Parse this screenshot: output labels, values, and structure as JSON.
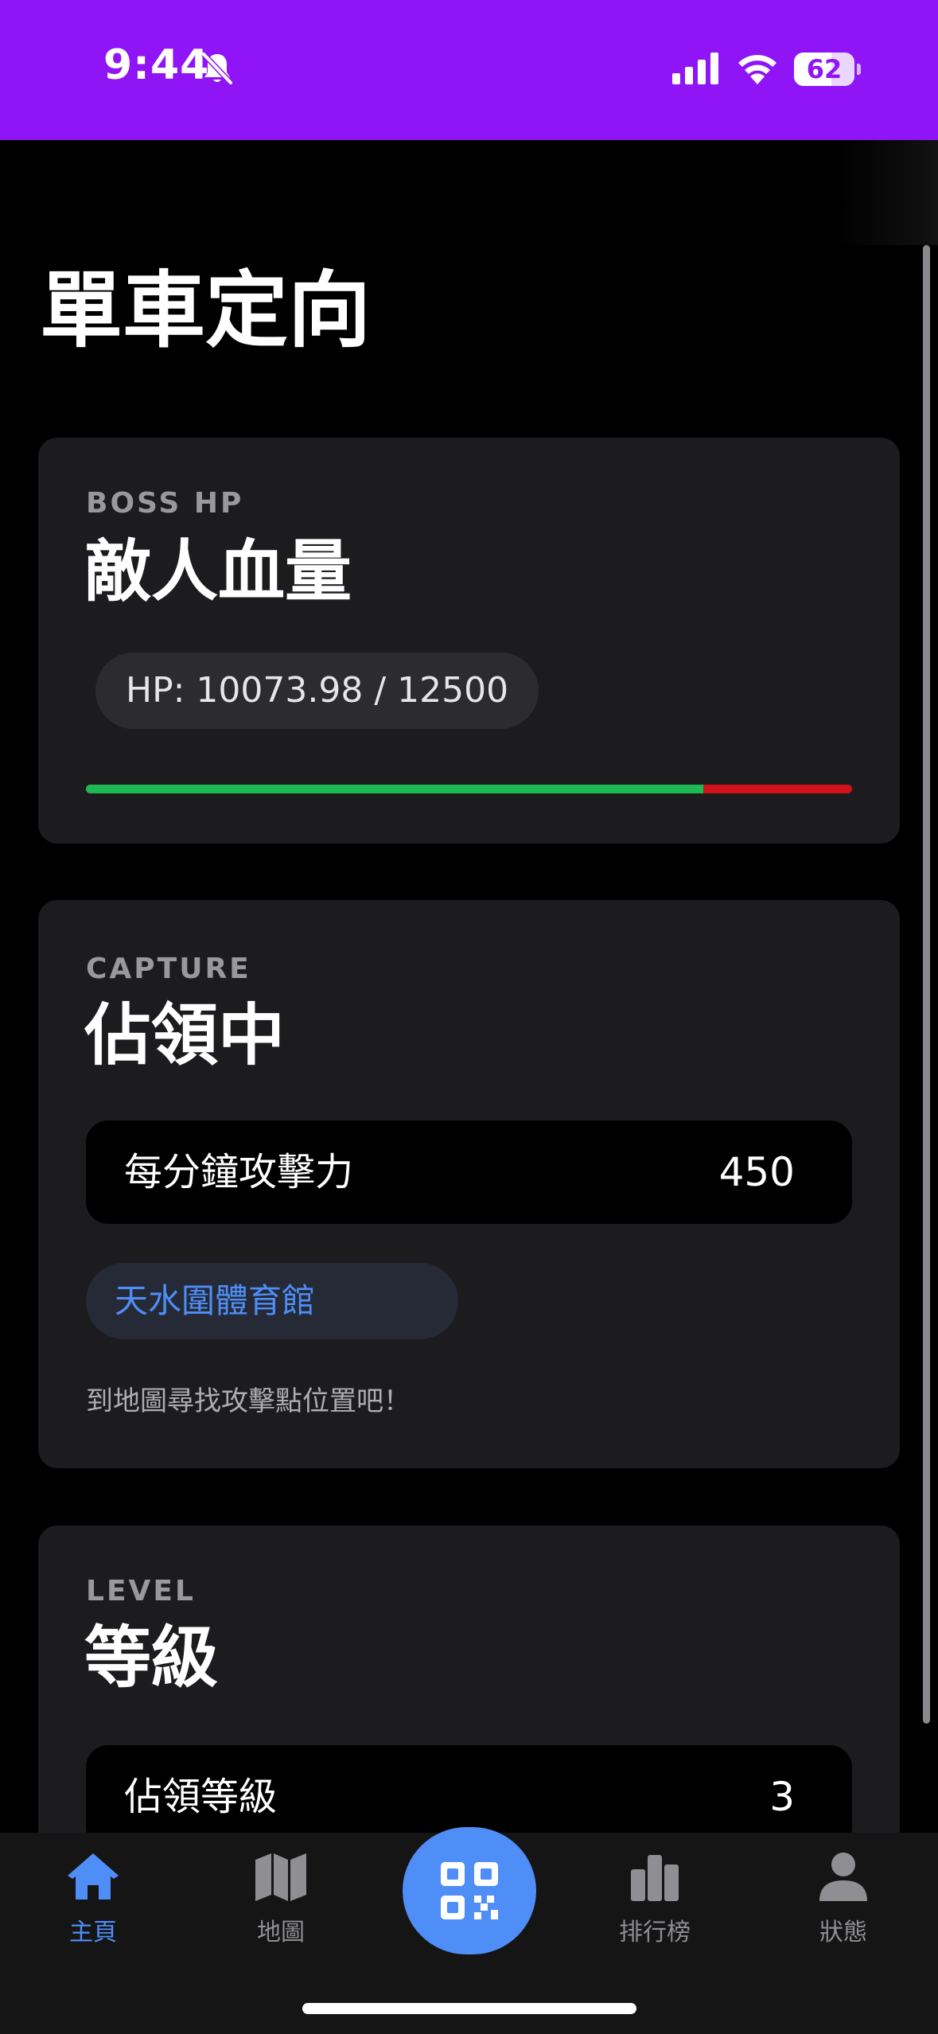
{
  "status_bar": {
    "time": "9:44",
    "battery_level": "62",
    "battery_fraction": 0.62,
    "background_color": "#8f14f6",
    "icons": [
      "bell-slash-icon",
      "cellular-signal-icon",
      "wifi-icon",
      "battery-icon"
    ]
  },
  "page": {
    "title": "單車定向"
  },
  "boss_card": {
    "eyebrow": "BOSS HP",
    "heading": "敵人血量",
    "hp_text": "HP: 10073.98 / 12500",
    "hp_current": 10073.98,
    "hp_max": 12500,
    "bar_colors": {
      "remaining": "#1db954",
      "lost": "#d1121b"
    }
  },
  "capture_card": {
    "eyebrow": "CAPTURE",
    "heading": "佔領中",
    "stat_label": "每分鐘攻擊力",
    "stat_value": "450",
    "location": "天水圍體育館",
    "hint": "到地圖尋找攻擊點位置吧！"
  },
  "level_card": {
    "eyebrow": "LEVEL",
    "heading": "等級",
    "stat_label": "佔領等級",
    "stat_value": "3"
  },
  "tab_bar": {
    "accent_color": "#4f8ef7",
    "tabs": [
      {
        "label": "主頁",
        "icon": "house-icon",
        "active": true
      },
      {
        "label": "地圖",
        "icon": "map-icon",
        "active": false
      },
      {
        "label": "",
        "icon": "qr-code-icon",
        "active": false
      },
      {
        "label": "排行榜",
        "icon": "bar-chart-icon",
        "active": false
      },
      {
        "label": "狀態",
        "icon": "person-icon",
        "active": false
      }
    ]
  }
}
